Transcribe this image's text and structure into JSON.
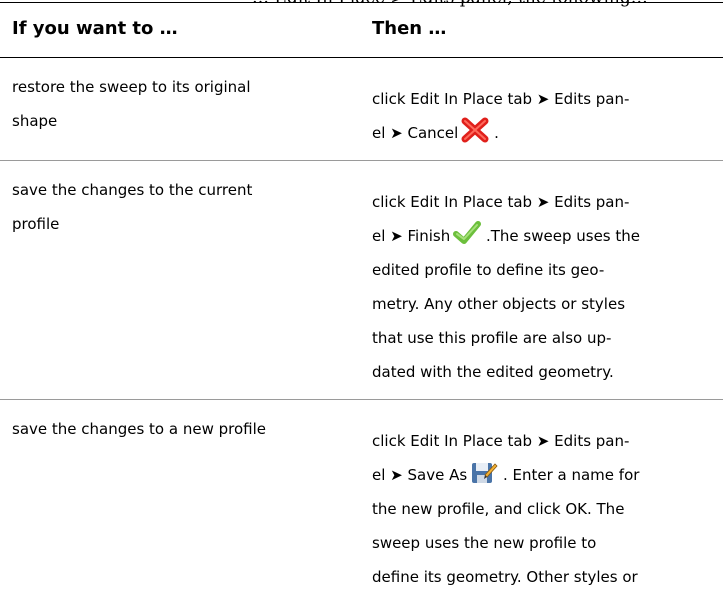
{
  "top_text": "… Edit In Place > Edits panel, the following…",
  "table": {
    "headers": [
      "If you want to …",
      "Then …"
    ],
    "rows": [
      {
        "condition_lines": [
          "restore the sweep to its original",
          "shape"
        ],
        "action_lines": [
          "click Edit In Place tab ➤ Edits pan-",
          "el ➤ Cancel",
          "."
        ],
        "icon": "cancel-x-icon"
      },
      {
        "condition_lines": [
          "save the changes to the current",
          "profile"
        ],
        "action_lines": [
          "click Edit In Place tab ➤ Edits pan-",
          "el ➤ Finish",
          ".The sweep uses the",
          "edited profile to define its geo-",
          "metry. Any other objects or styles",
          "that use this profile are also up-",
          "dated with the edited geometry."
        ],
        "icon": "finish-checkmark-icon"
      },
      {
        "condition_lines": [
          "save the changes to a new profile"
        ],
        "action_lines": [
          "click Edit In Place tab ➤ Edits pan-",
          "el ➤ Save As",
          ". Enter a name for",
          "the new profile, and click OK. The",
          "sweep uses the new profile to",
          "define its geometry. Other styles or"
        ],
        "icon": "save-as-icon"
      }
    ]
  },
  "colors": {
    "cancel_red": "#e0201b",
    "finish_green": "#6cbf3c",
    "rule_gray": "#9a9a9a"
  }
}
